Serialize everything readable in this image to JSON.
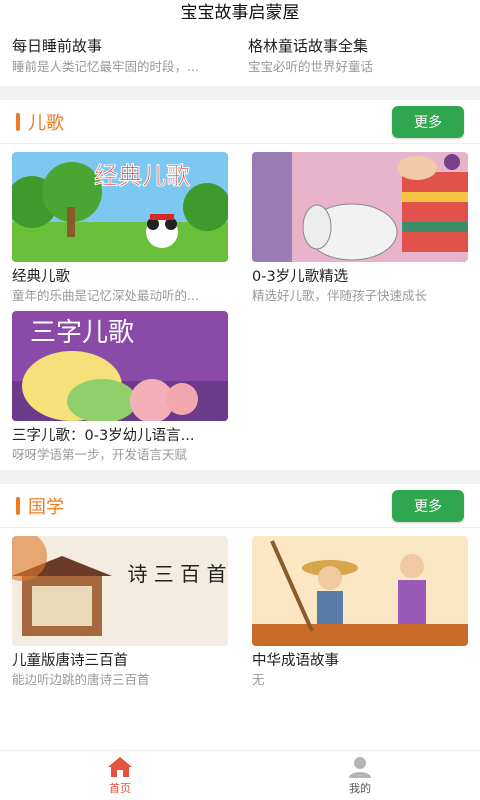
{
  "header": {
    "title": "宝宝故事启蒙屋"
  },
  "stories": [
    {
      "title": "每日睡前故事",
      "desc": "睡前是人类记忆最牢固的时段，..."
    },
    {
      "title": "格林童话故事全集",
      "desc": "宝宝必听的世界好童话"
    }
  ],
  "sections": [
    {
      "title": "儿歌",
      "more_label": "更多",
      "cards": [
        {
          "title": "经典儿歌",
          "desc": "童年的乐曲是记忆深处最动听的...",
          "thumb_text": "经典儿歌"
        },
        {
          "title": "0-3岁儿歌精选",
          "desc": "精选好儿歌，伴随孩子快速成长"
        },
        {
          "title": "三字儿歌：0-3岁幼儿语言...",
          "desc": "呀呀学语第一步，开发语言天赋",
          "thumb_text": "三字儿歌"
        }
      ]
    },
    {
      "title": "国学",
      "more_label": "更多",
      "cards": [
        {
          "title": "儿童版唐诗三百首",
          "desc": "能边听边跳的唐诗三百首",
          "thumb_text": "诗 三 百 首"
        },
        {
          "title": "中华成语故事",
          "desc": "无"
        }
      ]
    }
  ],
  "tabbar": {
    "items": [
      {
        "label": "首页",
        "icon": "home-icon",
        "active": true
      },
      {
        "label": "我的",
        "icon": "user-icon",
        "active": false
      }
    ]
  },
  "colors": {
    "accent": "#f07a22",
    "button": "#2fa84f",
    "active_tab": "#e5533d"
  }
}
